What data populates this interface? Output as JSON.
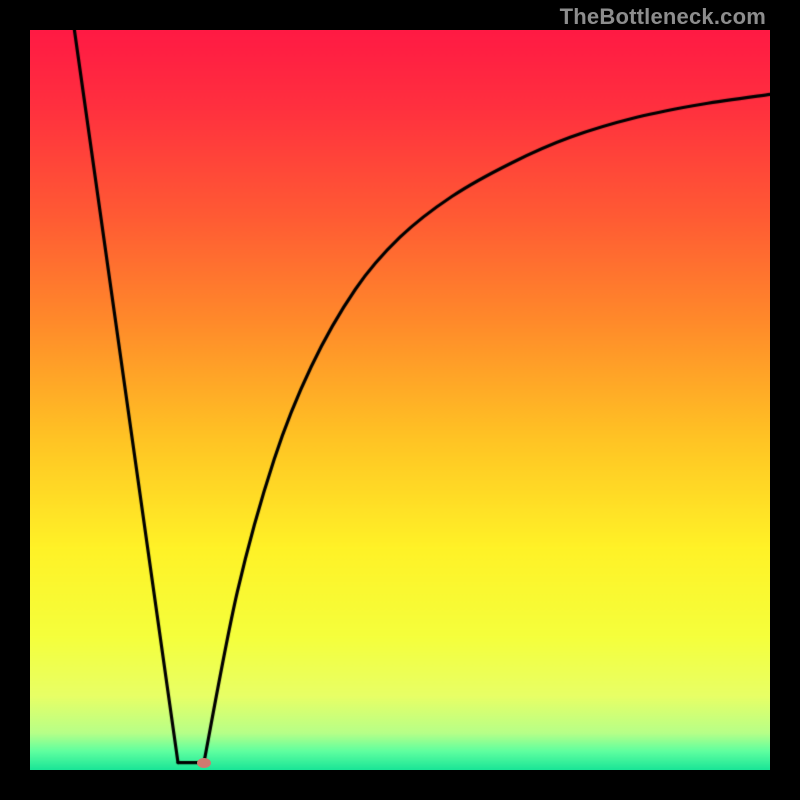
{
  "watermark": "TheBottleneck.com",
  "gradient": {
    "stops": [
      {
        "pos": 0.0,
        "color": "#ff1a44"
      },
      {
        "pos": 0.1,
        "color": "#ff2f3f"
      },
      {
        "pos": 0.25,
        "color": "#ff5a34"
      },
      {
        "pos": 0.4,
        "color": "#ff8c2a"
      },
      {
        "pos": 0.55,
        "color": "#ffc324"
      },
      {
        "pos": 0.7,
        "color": "#fff227"
      },
      {
        "pos": 0.82,
        "color": "#f5ff3c"
      },
      {
        "pos": 0.9,
        "color": "#e8ff66"
      },
      {
        "pos": 0.95,
        "color": "#b7ff88"
      },
      {
        "pos": 0.975,
        "color": "#5effa0"
      },
      {
        "pos": 1.0,
        "color": "#19e597"
      }
    ]
  },
  "chart_data": {
    "type": "line",
    "title": "",
    "xlabel": "",
    "ylabel": "",
    "xlim": [
      0,
      1
    ],
    "ylim": [
      0,
      1
    ],
    "series": [
      {
        "name": "left-segment",
        "x": [
          0.06,
          0.2
        ],
        "y": [
          1.0,
          0.01
        ]
      },
      {
        "name": "valley-floor",
        "x": [
          0.2,
          0.235
        ],
        "y": [
          0.01,
          0.01
        ]
      },
      {
        "name": "right-curve",
        "x": [
          0.235,
          0.28,
          0.33,
          0.38,
          0.44,
          0.5,
          0.57,
          0.65,
          0.73,
          0.82,
          0.91,
          1.0
        ],
        "y": [
          0.01,
          0.24,
          0.42,
          0.545,
          0.65,
          0.72,
          0.775,
          0.82,
          0.855,
          0.882,
          0.9,
          0.913
        ]
      }
    ],
    "annotations": [
      {
        "name": "minimum-marker",
        "x": 0.235,
        "y": 0.01
      }
    ]
  },
  "colors": {
    "curve": "#000000",
    "marker": "#cf7a70"
  }
}
